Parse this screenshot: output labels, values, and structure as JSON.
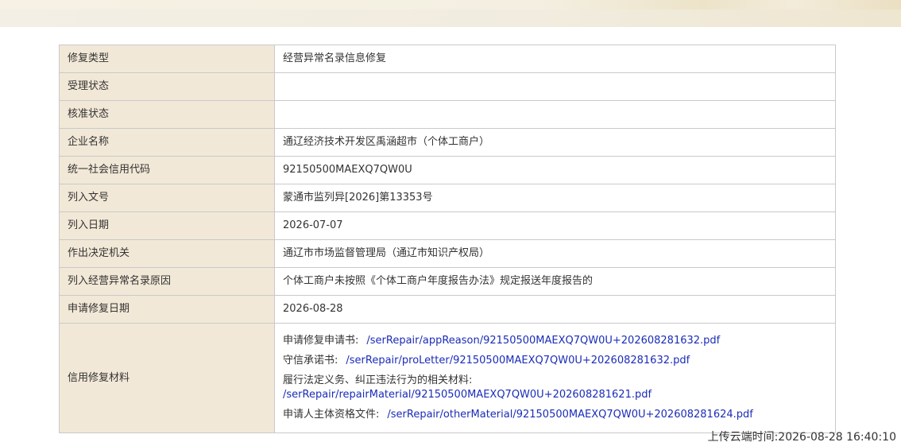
{
  "rows": [
    {
      "label": "修复类型",
      "value": "经营异常名录信息修复"
    },
    {
      "label": "受理状态",
      "value": ""
    },
    {
      "label": "核准状态",
      "value": ""
    },
    {
      "label": "企业名称",
      "value": "通辽经济技术开发区禹涵超市（个体工商户）"
    },
    {
      "label": "统一社会信用代码",
      "value": "92150500MAEXQ7QW0U"
    },
    {
      "label": "列入文号",
      "value": "蒙通市监列异[2026]第13353号"
    },
    {
      "label": "列入日期",
      "value": "2026-07-07"
    },
    {
      "label": "作出决定机关",
      "value": "通辽市市场监督管理局（通辽市知识产权局）"
    },
    {
      "label": "列入经营异常名录原因",
      "value": "个体工商户未按照《个体工商户年度报告办法》规定报送年度报告的"
    },
    {
      "label": "申请修复日期",
      "value": "2026-08-28"
    }
  ],
  "materials": {
    "label": "信用修复材料",
    "items": [
      {
        "label": "申请修复申请书:",
        "link": "/serRepair/appReason/92150500MAEXQ7QW0U+202608281632.pdf"
      },
      {
        "label": "守信承诺书:",
        "link": "/serRepair/proLetter/92150500MAEXQ7QW0U+202608281632.pdf"
      },
      {
        "label": "履行法定义务、纠正违法行为的相关材料:",
        "link": "/serRepair/repairMaterial/92150500MAEXQ7QW0U+202608281621.pdf"
      },
      {
        "label": "申请人主体资格文件:",
        "link": "/serRepair/otherMaterial/92150500MAEXQ7QW0U+202608281624.pdf"
      }
    ]
  },
  "footer": {
    "upload_time": "上传云端时间:2026-08-28 16:40:10"
  },
  "colors": {
    "label_bg": "#f2e8d7",
    "link": "#1a2cb8",
    "border": "#c9c9c9"
  }
}
